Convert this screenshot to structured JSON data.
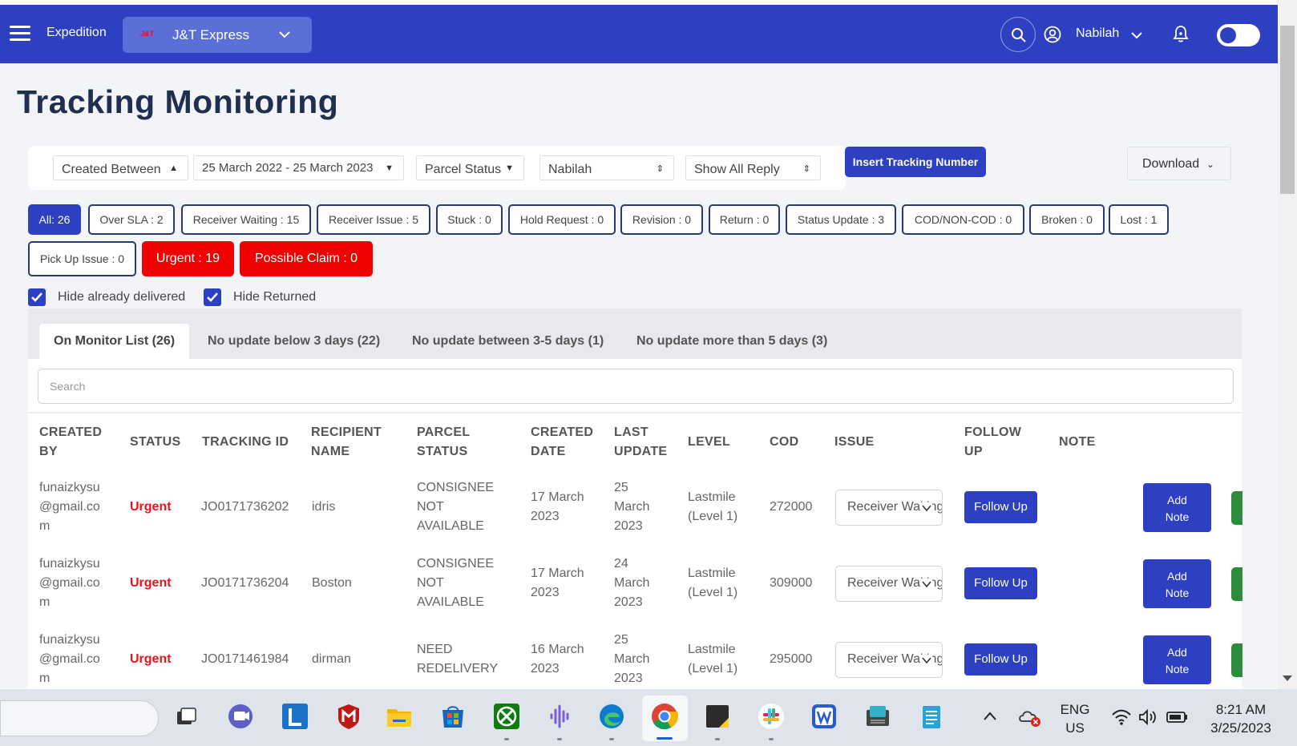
{
  "header": {
    "app_title": "Expedition",
    "courier": {
      "logo": "J&T",
      "name": "J&T Express"
    },
    "user": "Nabilah"
  },
  "page": {
    "title": "Tracking Monitoring"
  },
  "filters": {
    "created_between": "Created Between",
    "date_range": "25 March 2022 - 25 March 2023",
    "parcel_status": "Parcel Status",
    "user": "Nabilah",
    "reply": "Show All Reply",
    "insert_button": "Insert Tracking Number",
    "download": "Download"
  },
  "chips": [
    "All: 26",
    "Over SLA : 2",
    "Receiver Waiting : 15",
    "Receiver Issue : 5",
    "Stuck : 0",
    "Hold Request : 0",
    "Revision : 0",
    "Return : 0",
    "Status Update : 3",
    "COD/NON-COD : 0",
    "Broken : 0",
    "Lost : 1",
    "Pick Up Issue : 0",
    "Urgent : 19",
    "Possible Claim : 0"
  ],
  "checkboxes": {
    "hide_delivered": "Hide already delivered",
    "hide_returned": "Hide Returned"
  },
  "tabs": [
    "On Monitor List (26)",
    "No update below 3 days (22)",
    "No update between 3-5 days (1)",
    "No update more than 5 days (3)"
  ],
  "search": {
    "placeholder": "Search"
  },
  "table": {
    "headers": {
      "created_by": [
        "CREATED",
        "BY"
      ],
      "status": "STATUS",
      "tracking_id": "TRACKING ID",
      "recipient": [
        "RECIPIENT",
        "NAME"
      ],
      "parcel_status": [
        "PARCEL",
        "STATUS"
      ],
      "created_date": [
        "CREATED",
        "DATE"
      ],
      "last_update": [
        "LAST",
        "UPDATE"
      ],
      "level": "LEVEL",
      "cod": "COD",
      "issue": "ISSUE",
      "follow_up": [
        "FOLLOW",
        "UP"
      ],
      "note": "NOTE"
    },
    "rows": [
      {
        "created_by": [
          "funaizkysu",
          "@gmail.co",
          "m"
        ],
        "status": "Urgent",
        "tracking_id": "JO0171736202",
        "recipient": "idris",
        "parcel_status": [
          "CONSIGNEE",
          "NOT",
          "AVAILABLE"
        ],
        "created_date": [
          "17 March",
          "2023"
        ],
        "last_update": [
          "25",
          "March",
          "2023"
        ],
        "level": [
          "Lastmile",
          "(Level 1)"
        ],
        "cod": "272000",
        "issue": "Receiver Waiting",
        "follow_up": "Follow Up",
        "note_btn": [
          "Add",
          "Note"
        ]
      },
      {
        "created_by": [
          "funaizkysu",
          "@gmail.co",
          "m"
        ],
        "status": "Urgent",
        "tracking_id": "JO0171736204",
        "recipient": "Boston",
        "parcel_status": [
          "CONSIGNEE",
          "NOT",
          "AVAILABLE"
        ],
        "created_date": [
          "17 March",
          "2023"
        ],
        "last_update": [
          "24",
          "March",
          "2023"
        ],
        "level": [
          "Lastmile",
          "(Level 1)"
        ],
        "cod": "309000",
        "issue": "Receiver Waiting",
        "follow_up": "Follow Up",
        "note_btn": [
          "Add",
          "Note"
        ]
      },
      {
        "created_by": [
          "funaizkysu",
          "@gmail.co",
          "m"
        ],
        "status": "Urgent",
        "tracking_id": "JO0171461984",
        "recipient": "dirman",
        "parcel_status": [
          "NEED",
          "REDELIVERY"
        ],
        "created_date": [
          "16 March",
          "2023"
        ],
        "last_update": [
          "25",
          "March",
          "2023"
        ],
        "level": [
          "Lastmile",
          "(Level 1)"
        ],
        "cod": "295000",
        "issue": "Receiver Waiting",
        "follow_up": "Follow Up",
        "note_btn": [
          "Add",
          "Note"
        ]
      }
    ]
  },
  "taskbar": {
    "lang": [
      "ENG",
      "US"
    ],
    "time": "8:21 AM",
    "date": "3/25/2023"
  },
  "colors": {
    "primary": "#2c40c1",
    "danger": "#f00000",
    "urgent_text": "#e8141c",
    "green": "#2e8b3a"
  }
}
